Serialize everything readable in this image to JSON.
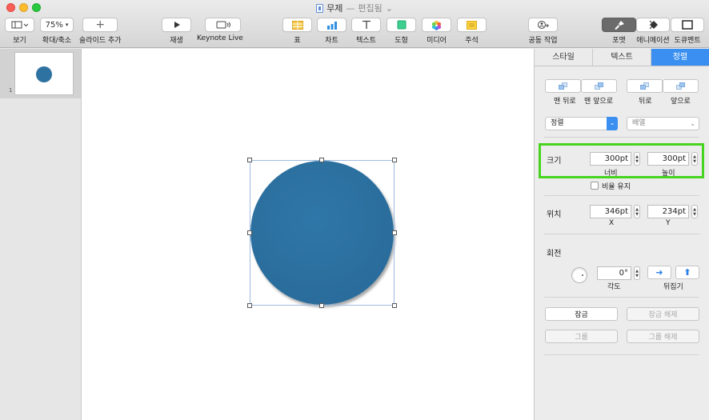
{
  "window": {
    "title": "무제",
    "separator": "—",
    "status": "편집됨",
    "status_chevron": "⌄"
  },
  "toolbar": {
    "view_label": "보기",
    "zoom_value": "75%",
    "zoom_label": "확대/축소",
    "add_slide_label": "슬라이드 추가",
    "play_label": "재생",
    "keynote_live_label": "Keynote Live",
    "table_label": "표",
    "chart_label": "차트",
    "text_label": "텍스트",
    "shape_label": "도형",
    "media_label": "미디어",
    "comment_label": "주석",
    "collaborate_label": "공동 작업",
    "format_label": "포맷",
    "animate_label": "애니메이션",
    "document_label": "도큐멘트"
  },
  "navigator": {
    "slides": [
      {
        "number": "1"
      }
    ]
  },
  "inspector": {
    "tabs": [
      "스타일",
      "텍스트",
      "정렬"
    ],
    "active_tab": "정렬",
    "arrange": {
      "back_label": "맨 뒤로",
      "front_label": "맨 앞으로",
      "backward_label": "뒤로",
      "forward_label": "앞으로"
    },
    "align_popup": "정렬",
    "distribute_popup": "배열",
    "size": {
      "section_label": "크기",
      "width_value": "300pt",
      "height_value": "300pt",
      "width_label": "너비",
      "height_label": "높이",
      "constrain_label": "비율 유지"
    },
    "position": {
      "section_label": "위치",
      "x_value": "346pt",
      "y_value": "234pt",
      "x_label": "X",
      "y_label": "Y"
    },
    "rotate": {
      "section_label": "회전",
      "angle_value": "0°",
      "angle_label": "각도",
      "flip_label": "뒤집기"
    },
    "lock_label": "잠금",
    "unlock_label": "잠금 해제",
    "group_label": "그룹",
    "ungroup_label": "그룹 해제"
  },
  "colors": {
    "accent": "#3a8ff0",
    "shape_fill": "#2e72a1",
    "highlight": "#46d41f"
  }
}
